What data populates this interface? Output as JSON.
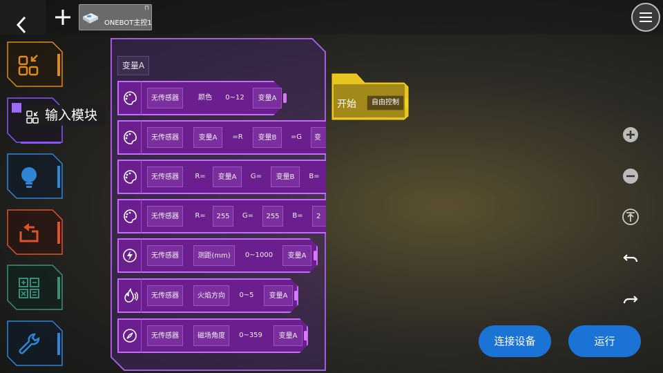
{
  "topbar": {
    "device_tab_label": "ONEBOT主控1",
    "device_tab_close": "⊓"
  },
  "sidebar": {
    "active_category_label": "输入模块",
    "categories": [
      {
        "name": "start",
        "color": "#e08a19"
      },
      {
        "name": "input",
        "color": "#8a55ff"
      },
      {
        "name": "light",
        "color": "#2f86d6"
      },
      {
        "name": "control",
        "color": "#e0522a"
      },
      {
        "name": "math",
        "color": "#3a8f7c"
      },
      {
        "name": "tools",
        "color": "#2f86d6"
      }
    ]
  },
  "panel": {
    "variable_chip": "变量A",
    "blocks": [
      {
        "icon": "palette-icon",
        "items": [
          "无传感器",
          "颜色",
          "0~12",
          "变量A"
        ]
      },
      {
        "icon": "palette-icon",
        "items": [
          "无传感器",
          "变量A",
          "=R",
          "变量B",
          "=G",
          "变"
        ]
      },
      {
        "icon": "palette-icon",
        "items": [
          "无传感器",
          "R=",
          "变量A",
          "G=",
          "变量B",
          "B="
        ]
      },
      {
        "icon": "palette-icon",
        "items": [
          "无传感器",
          "R=",
          "255",
          "G=",
          "255",
          "B=",
          "2"
        ]
      },
      {
        "icon": "lightning-icon",
        "items": [
          "无传感器",
          "测距(mm)",
          "0~1000",
          "变量A"
        ]
      },
      {
        "icon": "flame-icon",
        "items": [
          "无传感器",
          "火焰方向",
          "0~5",
          "变量A"
        ]
      },
      {
        "icon": "compass-icon",
        "items": [
          "无传感器",
          "磁场角度",
          "0~359",
          "变量A"
        ]
      }
    ]
  },
  "canvas": {
    "start_block_label": "开始",
    "start_block_mode": "自由控制"
  },
  "buttons": {
    "connect_label": "连接设备",
    "run_label": "运行"
  },
  "colors": {
    "accent_blue": "#1b73d6",
    "block_purple": "#6b1f8e",
    "start_yellow": "#f5d020"
  }
}
